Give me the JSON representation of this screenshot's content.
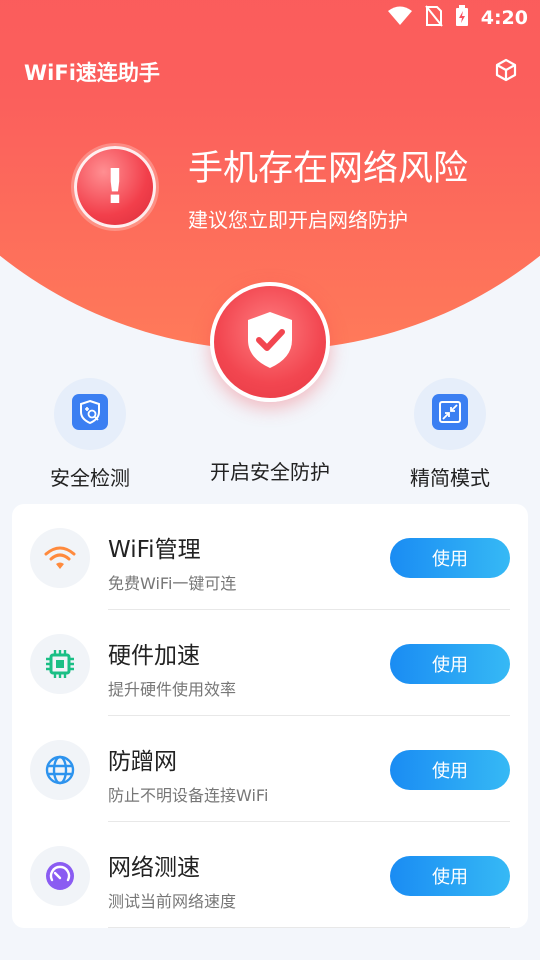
{
  "status": {
    "time": "4:20"
  },
  "app": {
    "title": "WiFi速连助手"
  },
  "hero": {
    "title": "手机存在网络风险",
    "subtitle": "建议您立即开启网络防护"
  },
  "shortcuts": [
    {
      "label": "安全检测"
    },
    {
      "label": "开启安全防护"
    },
    {
      "label": "精简模式"
    }
  ],
  "features": [
    {
      "title": "WiFi管理",
      "subtitle": "免费WiFi一键可连",
      "button": "使用"
    },
    {
      "title": "硬件加速",
      "subtitle": "提升硬件使用效率",
      "button": "使用"
    },
    {
      "title": "防蹭网",
      "subtitle": "防止不明设备连接WiFi",
      "button": "使用"
    },
    {
      "title": "网络测速",
      "subtitle": "测试当前网络速度",
      "button": "使用"
    }
  ],
  "colors": {
    "hero_red": "#f9505e",
    "button_blue": "#1a8cf3"
  }
}
